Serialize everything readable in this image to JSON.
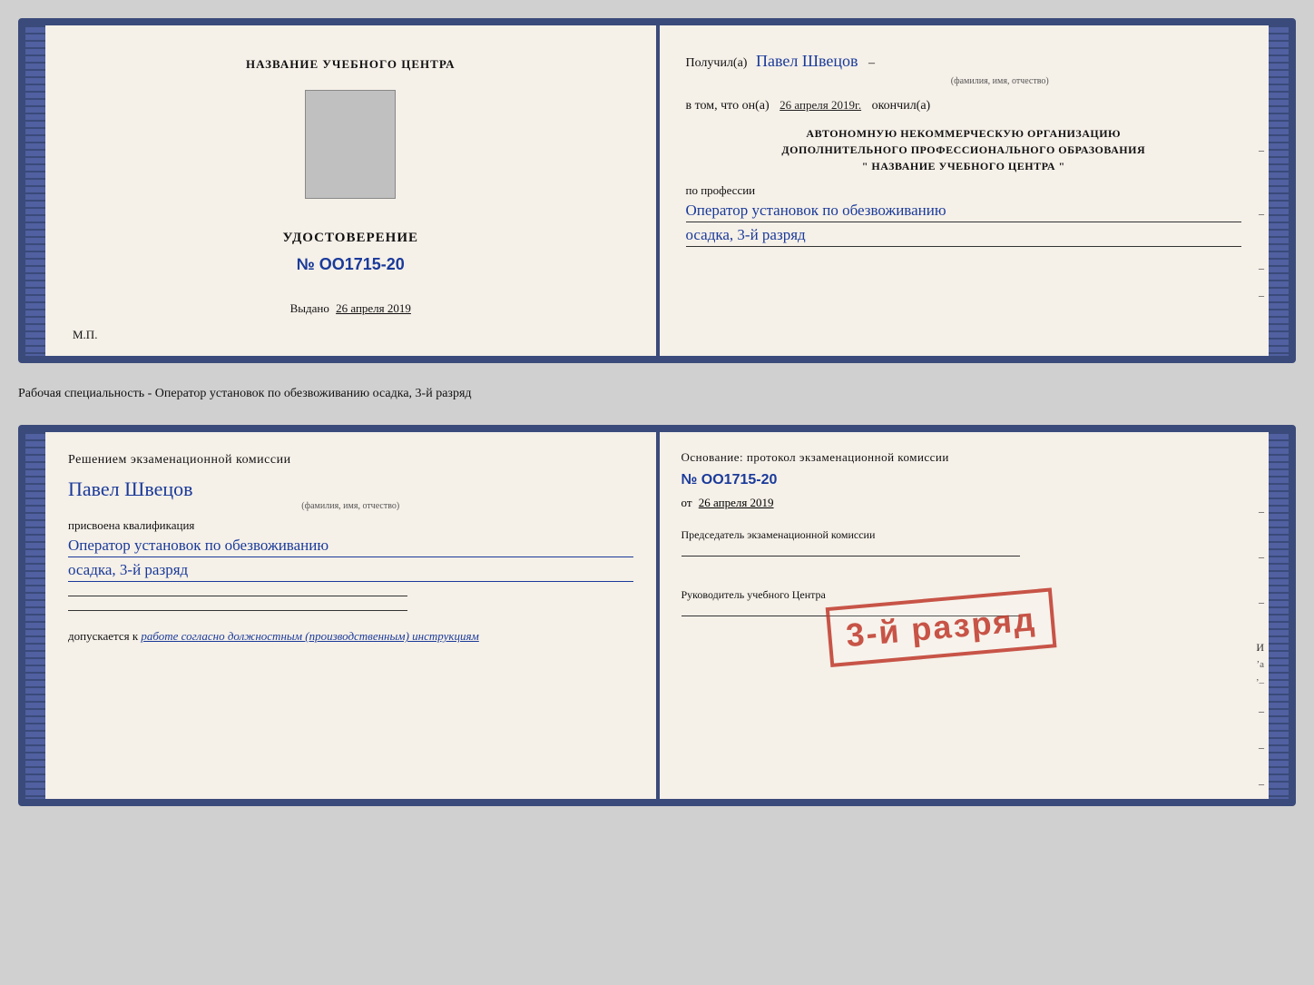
{
  "doc1": {
    "left": {
      "center_title": "НАЗВАНИЕ УЧЕБНОГО ЦЕНТРА",
      "cert_label": "УДОСТОВЕРЕНИЕ",
      "cert_number": "№ OO1715-20",
      "issued_prefix": "Выдано",
      "issued_date": "26 апреля 2019",
      "mp_label": "М.П."
    },
    "right": {
      "received_prefix": "Получил(а)",
      "recipient_name": "Павел Швецов",
      "fio_label": "(фамилия, имя, отчество)",
      "in_that_prefix": "в том, что он(а)",
      "in_that_date": "26 апреля 2019г.",
      "completed_label": "окончил(а)",
      "org_line1": "АВТОНОМНУЮ НЕКОММЕРЧЕСКУЮ ОРГАНИЗАЦИЮ",
      "org_line2": "ДОПОЛНИТЕЛЬНОГО ПРОФЕССИОНАЛЬНОГО ОБРАЗОВАНИЯ",
      "org_line3": "\"   НАЗВАНИЕ УЧЕБНОГО ЦЕНТРА   \"",
      "profession_prefix": "по профессии",
      "profession_value": "Оператор установок по обезвоживанию",
      "profession_value2": "осадка, 3-й разряд"
    }
  },
  "between": {
    "label": "Рабочая специальность - Оператор установок по обезвоживанию осадка, 3-й разряд"
  },
  "doc2": {
    "left": {
      "decision_text": "Решением экзаменационной комиссии",
      "person_name": "Павел Швецов",
      "fio_label": "(фамилия, имя, отчество)",
      "qualification_prefix": "присвоена квалификация",
      "qualification_value1": "Оператор установок по обезвоживанию",
      "qualification_value2": "осадка, 3-й разряд",
      "bottom_prefix": "допускается к",
      "bottom_value": "работе согласно должностным (производственным) инструкциям"
    },
    "right": {
      "basis_text": "Основание: протокол экзаменационной комиссии",
      "protocol_number": "№  OO1715-20",
      "date_prefix": "от",
      "date_value": "26 апреля 2019",
      "chairman_label": "Председатель экзаменационной комиссии",
      "director_label": "Руководитель учебного Центра"
    },
    "stamp": {
      "text": "3-й разряд"
    }
  }
}
